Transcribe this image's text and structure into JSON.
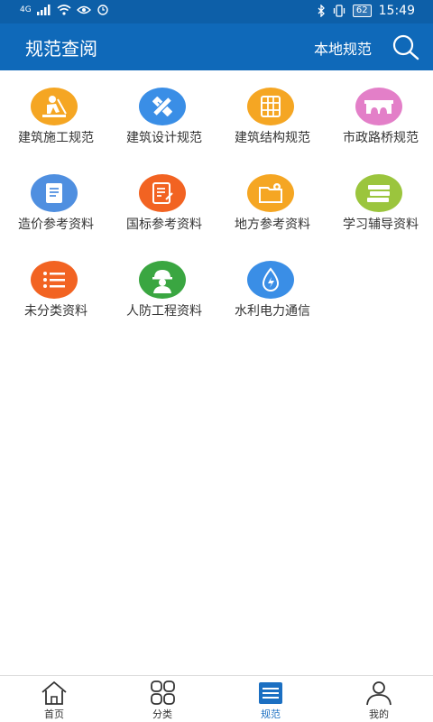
{
  "status_bar": {
    "network": "4G",
    "battery": "62",
    "time": "15:49"
  },
  "header": {
    "title": "规范查阅",
    "local_label": "本地规范"
  },
  "categories": [
    {
      "label": "建筑施工规范",
      "icon": "construction-worker-icon",
      "color": "#f5a623"
    },
    {
      "label": "建筑设计规范",
      "icon": "ruler-pencil-icon",
      "color": "#3a8ee6"
    },
    {
      "label": "建筑结构规范",
      "icon": "structure-grid-icon",
      "color": "#f5a623"
    },
    {
      "label": "市政路桥规范",
      "icon": "bridge-icon",
      "color": "#e37fc8"
    },
    {
      "label": "造价参考资料",
      "icon": "document-icon",
      "color": "#4f8fe0"
    },
    {
      "label": "国标参考资料",
      "icon": "form-icon",
      "color": "#f26322"
    },
    {
      "label": "地方参考资料",
      "icon": "folder-icon",
      "color": "#f5a623"
    },
    {
      "label": "学习辅导资料",
      "icon": "books-icon",
      "color": "#9bc53d"
    },
    {
      "label": "未分类资料",
      "icon": "list-icon",
      "color": "#f26322"
    },
    {
      "label": "人防工程资料",
      "icon": "helmet-worker-icon",
      "color": "#3aa641"
    },
    {
      "label": "水利电力通信",
      "icon": "water-drop-icon",
      "color": "#3a8ee6"
    }
  ],
  "tabs": [
    {
      "label": "首页",
      "icon": "home-icon"
    },
    {
      "label": "分类",
      "icon": "category-grid-icon"
    },
    {
      "label": "规范",
      "icon": "standards-list-icon",
      "active": true
    },
    {
      "label": "我的",
      "icon": "profile-icon"
    }
  ],
  "colors": {
    "status_bar": "#0d5fa8",
    "app_bar": "#0f69b9",
    "active_tab": "#1b6fc2"
  }
}
